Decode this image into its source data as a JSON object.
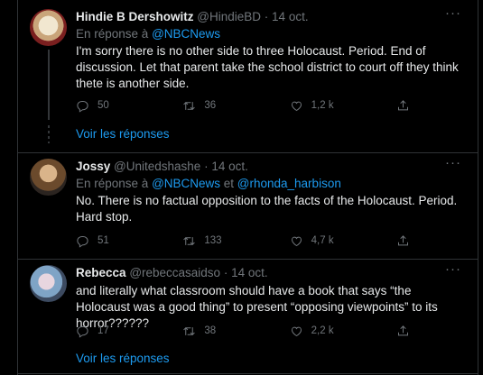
{
  "tweets": [
    {
      "name": "Hindie B Dershowitz",
      "handle": "@HindieBD",
      "date": "14 oct.",
      "reply_prefix": "En réponse à ",
      "mentions": [
        "@NBCNews"
      ],
      "text": "I'm sorry there is no other side to three Holocaust. Period. End of discussion. Let that parent take the school district to court off they think thete is another side.",
      "replies": "50",
      "retweets": "36",
      "likes": "1,2 k",
      "show_replies": "Voir les réponses"
    },
    {
      "name": "Jossy",
      "handle": "@Unitedshashe",
      "date": "14 oct.",
      "reply_prefix": "En réponse à ",
      "mentions": [
        "@NBCNews",
        "@rhonda_harbison"
      ],
      "joiner": " et ",
      "text": "No. There is no factual opposition to the facts of the Holocaust. Period. Hard stop.",
      "replies": "51",
      "retweets": "133",
      "likes": "4,7 k"
    },
    {
      "name": "Rebecca",
      "handle": "@rebeccasaidso",
      "date": "14 oct.",
      "text": "and literally what classroom should have a book that says “the Holocaust was a good thing” to present “opposing viewpoints” to its horror??????",
      "replies": "17",
      "retweets": "38",
      "likes": "2,2 k",
      "show_replies": "Voir les réponses"
    }
  ],
  "separator": "·",
  "more_label": "···",
  "colors": {
    "background": "#000000",
    "text": "#e7e9ea",
    "muted": "#71767b",
    "accent": "#1d9bf0",
    "border": "#2f3336"
  },
  "icons": [
    "reply-icon",
    "retweet-icon",
    "like-icon",
    "share-icon",
    "more-icon"
  ]
}
